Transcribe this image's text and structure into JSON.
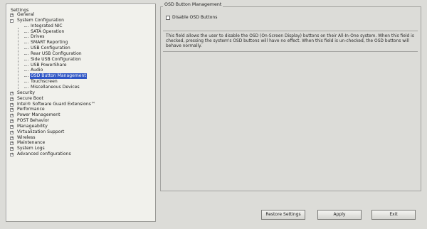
{
  "tree": {
    "title": "Settings",
    "items": [
      {
        "label": "General",
        "level": 0,
        "expander": "+"
      },
      {
        "label": "System Configuration",
        "level": 0,
        "expander": "-"
      },
      {
        "label": "Integrated NIC",
        "level": 2
      },
      {
        "label": "SATA Operation",
        "level": 2
      },
      {
        "label": "Drives",
        "level": 2
      },
      {
        "label": "SMART Reporting",
        "level": 2
      },
      {
        "label": "USB Configuration",
        "level": 2
      },
      {
        "label": "Rear USB Configuration",
        "level": 2
      },
      {
        "label": "Side USB Configuration",
        "level": 2
      },
      {
        "label": "USB PowerShare",
        "level": 2
      },
      {
        "label": "Audio",
        "level": 2
      },
      {
        "label": "OSD Button Management",
        "level": 2,
        "selected": true
      },
      {
        "label": "Touchscreen",
        "level": 2
      },
      {
        "label": "Miscellaneous Devices",
        "level": 2
      },
      {
        "label": "Security",
        "level": 0,
        "expander": "+"
      },
      {
        "label": "Secure Boot",
        "level": 0,
        "expander": "+"
      },
      {
        "label": "Intel® Software Guard Extensions™",
        "level": 0,
        "expander": "+"
      },
      {
        "label": "Performance",
        "level": 0,
        "expander": "+"
      },
      {
        "label": "Power Management",
        "level": 0,
        "expander": "+"
      },
      {
        "label": "POST Behavior",
        "level": 0,
        "expander": "+"
      },
      {
        "label": "Manageability",
        "level": 0,
        "expander": "+"
      },
      {
        "label": "Virtualization Support",
        "level": 0,
        "expander": "+"
      },
      {
        "label": "Wireless",
        "level": 0,
        "expander": "+"
      },
      {
        "label": "Maintenance",
        "level": 0,
        "expander": "+"
      },
      {
        "label": "System Logs",
        "level": 0,
        "expander": "+"
      },
      {
        "label": "Advanced configurations",
        "level": 0,
        "expander": "+"
      }
    ]
  },
  "detail": {
    "group_title": "OSD Button Management",
    "checkbox_label": "Disable OSD Buttons",
    "checkbox_checked": false,
    "description": "This field allows the user to disable the OSD (On-Screen Display) buttons on their All-In-One system. When this field is checked, pressing the system's OSD buttons will have no effect. When this field is un-checked, the OSD buttons will behave normally."
  },
  "buttons": {
    "restore": "Restore Settings",
    "apply": "Apply",
    "exit": "Exit"
  },
  "colors": {
    "selection": "#2f56c5",
    "background": "#dcdcd8"
  }
}
